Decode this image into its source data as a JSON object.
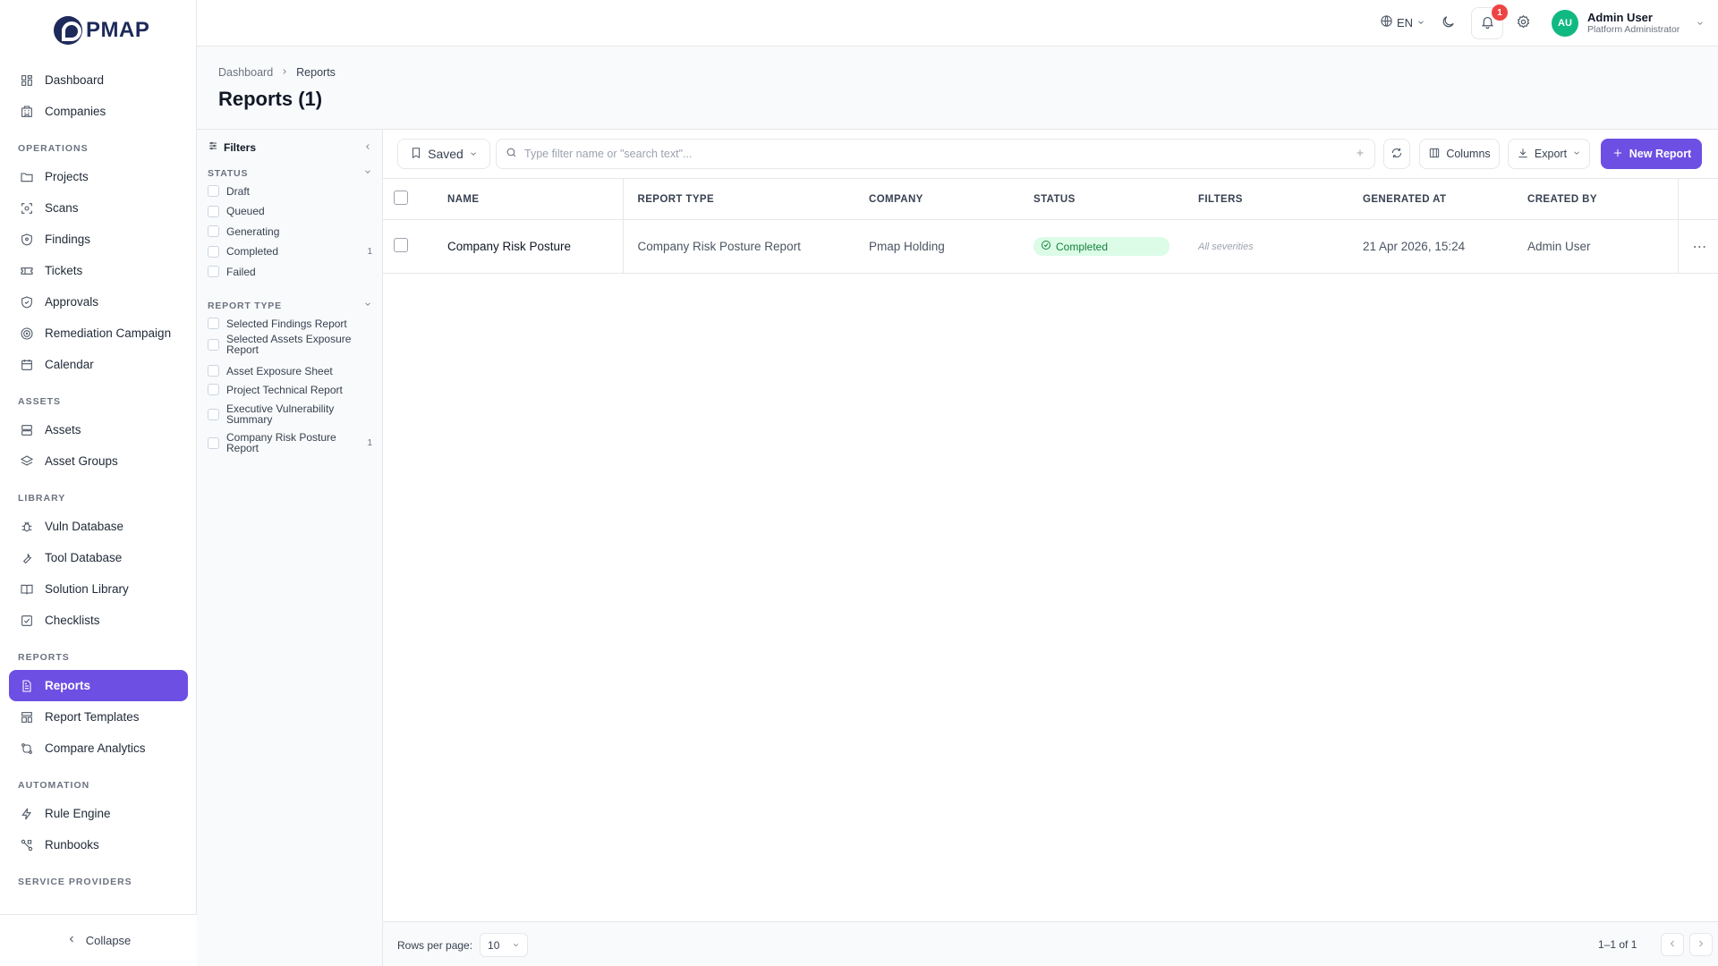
{
  "app": {
    "logo_text": "PMAP"
  },
  "sidebar": {
    "items": [
      {
        "label": "Dashboard",
        "icon": "dashboard-icon"
      },
      {
        "label": "Companies",
        "icon": "building-icon"
      }
    ],
    "sections": [
      {
        "title": "OPERATIONS",
        "items": [
          {
            "label": "Projects",
            "icon": "folder-icon"
          },
          {
            "label": "Scans",
            "icon": "scan-icon"
          },
          {
            "label": "Findings",
            "icon": "shield-icon"
          },
          {
            "label": "Tickets",
            "icon": "ticket-icon"
          },
          {
            "label": "Approvals",
            "icon": "shield-check-icon"
          },
          {
            "label": "Remediation Campaign",
            "icon": "target-icon"
          },
          {
            "label": "Calendar",
            "icon": "calendar-icon"
          }
        ]
      },
      {
        "title": "ASSETS",
        "items": [
          {
            "label": "Assets",
            "icon": "server-icon"
          },
          {
            "label": "Asset Groups",
            "icon": "layers-icon"
          }
        ]
      },
      {
        "title": "LIBRARY",
        "items": [
          {
            "label": "Vuln Database",
            "icon": "bug-icon"
          },
          {
            "label": "Tool Database",
            "icon": "wrench-icon"
          },
          {
            "label": "Solution Library",
            "icon": "book-icon"
          },
          {
            "label": "Checklists",
            "icon": "checklist-icon"
          }
        ]
      },
      {
        "title": "REPORTS",
        "items": [
          {
            "label": "Reports",
            "icon": "file-icon",
            "active": true
          },
          {
            "label": "Report Templates",
            "icon": "template-icon"
          },
          {
            "label": "Compare Analytics",
            "icon": "compare-icon"
          }
        ]
      },
      {
        "title": "AUTOMATION",
        "items": [
          {
            "label": "Rule Engine",
            "icon": "bolt-icon"
          },
          {
            "label": "Runbooks",
            "icon": "workflow-icon"
          }
        ]
      },
      {
        "title": "SERVICE PROVIDERS",
        "items": []
      }
    ],
    "collapse_label": "Collapse"
  },
  "topbar": {
    "language": "EN",
    "notification_count": "1",
    "user_initials": "AU",
    "user_name": "Admin User",
    "user_role": "Platform Administrator"
  },
  "header": {
    "breadcrumb": [
      "Dashboard",
      "Reports"
    ],
    "title": "Reports (1)"
  },
  "filters": {
    "title": "Filters",
    "status_title": "STATUS",
    "status_options": [
      {
        "label": "Draft",
        "count": ""
      },
      {
        "label": "Queued",
        "count": ""
      },
      {
        "label": "Generating",
        "count": ""
      },
      {
        "label": "Completed",
        "count": "1"
      },
      {
        "label": "Failed",
        "count": ""
      }
    ],
    "type_title": "REPORT TYPE",
    "type_options": [
      {
        "label": "Selected Findings Report",
        "count": ""
      },
      {
        "label": "Selected Assets Exposure Report",
        "count": ""
      },
      {
        "label": "Asset Exposure Sheet",
        "count": ""
      },
      {
        "label": "Project Technical Report",
        "count": ""
      },
      {
        "label": "Executive Vulnerability Summary",
        "count": ""
      },
      {
        "label": "Company Risk Posture Report",
        "count": "1"
      }
    ]
  },
  "toolbar": {
    "saved_label": "Saved",
    "search_placeholder": "Type filter name or \"search text\"...",
    "columns_label": "Columns",
    "export_label": "Export",
    "new_label": "New Report"
  },
  "table": {
    "columns": [
      "NAME",
      "REPORT TYPE",
      "COMPANY",
      "STATUS",
      "FILTERS",
      "GENERATED AT",
      "CREATED BY"
    ],
    "rows": [
      {
        "name": "Company Risk Posture",
        "report_type": "Company Risk Posture Report",
        "company": "Pmap Holding",
        "status": "Completed",
        "filters": "All severities",
        "generated_at": "21 Apr 2026, 15:24",
        "created_by": "Admin User"
      }
    ]
  },
  "footer": {
    "rows_per_page_label": "Rows per page:",
    "rows_per_page": "10",
    "page_info": "1–1 of 1"
  },
  "colors": {
    "accent": "#6d4fe3",
    "success": "#15803d",
    "success_bg": "#dcfce7",
    "badge": "#ef4444"
  }
}
